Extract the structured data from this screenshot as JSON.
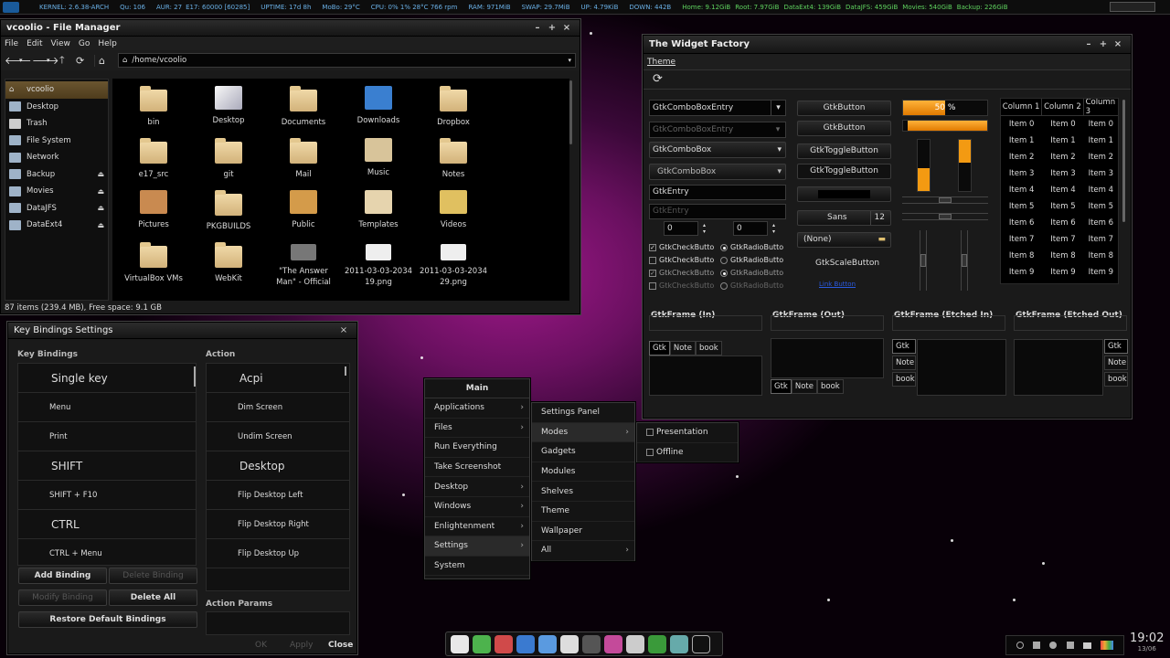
{
  "colors": {
    "accent": "#f39a12",
    "selection": "#5c4725",
    "desktop": "#8f1580"
  },
  "statusbar": {
    "kernel": "KERNEL: 2.6.38-ARCH",
    "qu": "Qu: 106",
    "aur": "AUR: 27",
    "e17": "E17: 60000 [60285]",
    "uptime": "UPTIME: 17d 8h",
    "mobo": "MoBo: 29°C",
    "cpu": "CPU:  0%   1%   28°C  766 rpm",
    "ram": "RAM: 971MiB",
    "swap": "SWAP: 29.7MiB",
    "up": "UP: 4.79KiB",
    "down": "DOWN: 442B",
    "home": "Home: 9.12GiB",
    "root": "Root: 7.97GiB",
    "dataext": "DataExt4: 139GiB",
    "datajfs": "DataJFS: 459GiB",
    "movies": "Movies: 540GiB",
    "backup": "Backup: 226GiB"
  },
  "filemanager": {
    "title": "vcoolio - File Manager",
    "menu": [
      "File",
      "Edit",
      "View",
      "Go",
      "Help"
    ],
    "path": "/home/vcoolio",
    "sidebar": [
      {
        "label": "vcoolio",
        "icon": "home-icon"
      },
      {
        "label": "Desktop",
        "icon": "desktop-icon"
      },
      {
        "label": "Trash",
        "icon": "trash-icon"
      },
      {
        "label": "File System",
        "icon": "drive-icon"
      },
      {
        "label": "Network",
        "icon": "network-icon"
      },
      {
        "label": "Backup",
        "icon": "drive-icon"
      },
      {
        "label": "Movies",
        "icon": "drive-icon"
      },
      {
        "label": "DataJFS",
        "icon": "drive-icon"
      },
      {
        "label": "DataExt4",
        "icon": "drive-icon"
      }
    ],
    "files": [
      "bin",
      "Desktop",
      "Documents",
      "Downloads",
      "Dropbox",
      "e17_src",
      "git",
      "Mail",
      "Music",
      "Notes",
      "Pictures",
      "PKGBUILDS",
      "Public",
      "Templates",
      "Videos",
      "VirtualBox VMs",
      "WebKit",
      "\"The Answer Man\" - Official",
      "2011-03-03-2034 19.png",
      "2011-03-03-2034 29.png"
    ],
    "status": "87 items (239.4 MB), Free space: 9.1 GB"
  },
  "keybindings": {
    "title": "Key Bindings Settings",
    "col1_header": "Key Bindings",
    "col2_header": "Action",
    "bindings": [
      "Single key",
      "Menu",
      "Print",
      "SHIFT",
      "SHIFT + F10",
      "CTRL",
      "CTRL + Menu"
    ],
    "actions": [
      "Acpi",
      "Dim Screen",
      "Undim Screen",
      "Desktop",
      "Flip Desktop Left",
      "Flip Desktop Right",
      "Flip Desktop Up"
    ],
    "add": "Add Binding",
    "delete": "Delete Binding",
    "modify": "Modify Binding",
    "delete_all": "Delete All",
    "restore": "Restore Default Bindings",
    "params": "Action Params",
    "ok": "OK",
    "apply": "Apply",
    "close": "Close"
  },
  "mainmenu": {
    "title": "Main",
    "items": [
      "Applications",
      "Files",
      "Run Everything",
      "Take Screenshot",
      "Desktop",
      "Windows",
      "Enlightenment",
      "Settings",
      "System"
    ],
    "settings_items": [
      "Settings Panel",
      "Modes",
      "Gadgets",
      "Modules",
      "Shelves",
      "Theme",
      "Wallpaper",
      "All"
    ],
    "modes_items": [
      "Presentation",
      "Offline"
    ]
  },
  "widgetfactory": {
    "title": "The Widget Factory",
    "menu": "Theme",
    "combo1": "GtkComboBoxEntry",
    "combo2": "GtkComboBoxEntry",
    "combo3": "GtkComboBox",
    "combo4": "GtkComboBox",
    "entry1": "GtkEntry",
    "entry2": "GtkEntry",
    "spin1": "0",
    "spin2": "0",
    "check": "GtkCheckButto",
    "radio": "GtkRadioButto",
    "button1": "GtkButton",
    "button2": "GtkButton",
    "toggle1": "GtkToggleButton",
    "toggle2": "GtkToggleButton",
    "font_name": "Sans",
    "font_size": "12",
    "file_none": "(None)",
    "scale_button": "GtkScaleButton",
    "link": "Link Button",
    "progress_text": "50 %",
    "progress": 0.5,
    "progress2": 0.95,
    "columns": [
      "Column 1",
      "Column 2",
      "Column 3"
    ],
    "rows": [
      "Item 0",
      "Item 1",
      "Item 2",
      "Item 3",
      "Item 4",
      "Item 5",
      "Item 6",
      "Item 7",
      "Item 8",
      "Item 9"
    ],
    "frames": [
      "GtkFrame (In)",
      "GtkFrame (Out)",
      "GtkFrame (Etched In)",
      "GtkFrame (Etched Out)"
    ],
    "tabs": [
      "Gtk",
      "Note",
      "book"
    ]
  },
  "tray": {
    "time": "19:02",
    "date": "13/06"
  }
}
